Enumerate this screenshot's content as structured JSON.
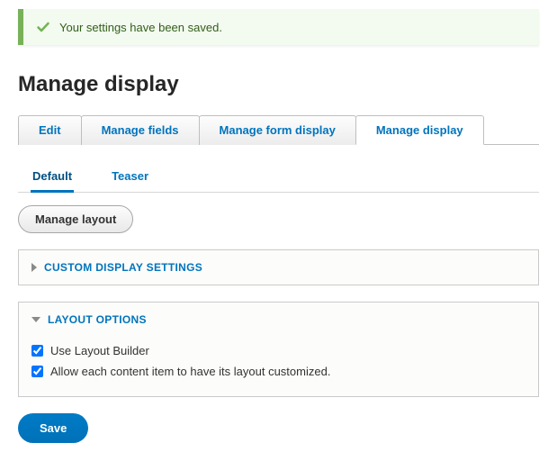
{
  "status": {
    "message": "Your settings have been saved.",
    "icon": "check-icon"
  },
  "page_title": "Manage display",
  "tabs_primary": [
    {
      "label": "Edit",
      "active": false
    },
    {
      "label": "Manage fields",
      "active": false
    },
    {
      "label": "Manage form display",
      "active": false
    },
    {
      "label": "Manage display",
      "active": true
    }
  ],
  "tabs_secondary": [
    {
      "label": "Default",
      "active": true
    },
    {
      "label": "Teaser",
      "active": false
    }
  ],
  "manage_layout_button": "Manage layout",
  "details": {
    "custom_display": {
      "title": "CUSTOM DISPLAY SETTINGS",
      "open": false
    },
    "layout_options": {
      "title": "LAYOUT OPTIONS",
      "open": true,
      "options": [
        {
          "label": "Use Layout Builder",
          "checked": true
        },
        {
          "label": "Allow each content item to have its layout customized.",
          "checked": true
        }
      ]
    }
  },
  "actions": {
    "save": "Save"
  },
  "colors": {
    "link": "#0074bd",
    "success_border": "#77b259",
    "success_bg": "#f3faef"
  }
}
